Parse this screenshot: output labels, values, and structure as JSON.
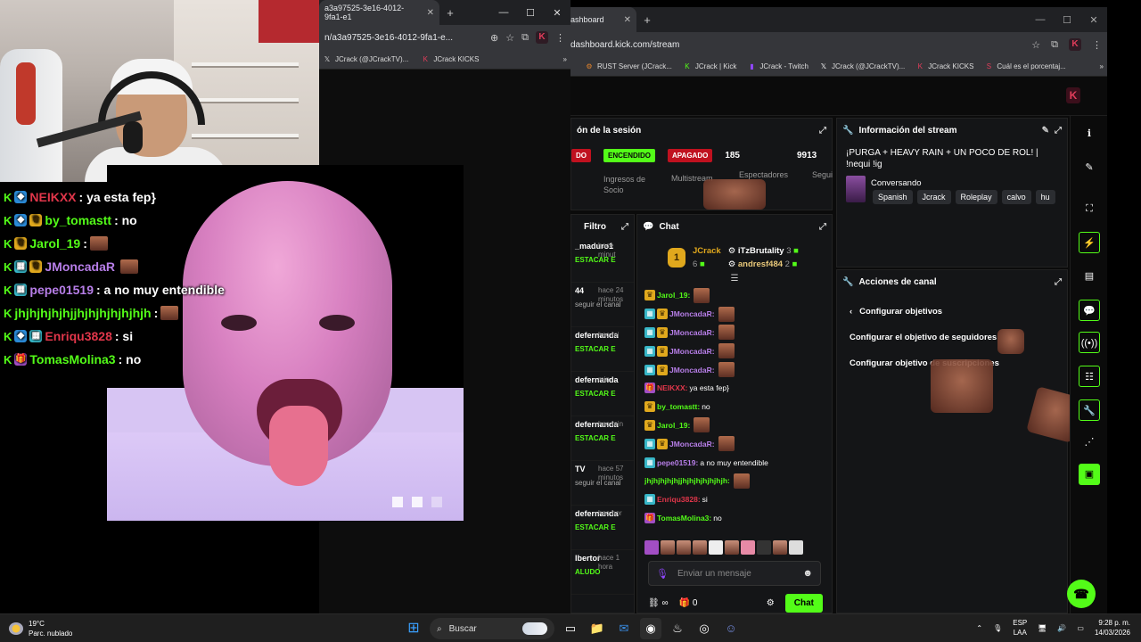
{
  "left_browser": {
    "tab_title": "a3a97525-3e16-4012-9fa1-e1",
    "address": "n/a3a97525-3e16-4012-9fa1-e...",
    "bookmarks": [
      "JCrack (@JCrackTV)...",
      "JCrack KICKS"
    ]
  },
  "overlay_chat": [
    {
      "user": "NEIKXX",
      "color": "#e0364a",
      "badges": [
        "blue"
      ],
      "message": ": ya esta fep}"
    },
    {
      "user": "by_tomastt",
      "color": "#53fc18",
      "badges": [
        "blue",
        "crown"
      ],
      "message": ": no"
    },
    {
      "user": "Jarol_19",
      "color": "#53fc18",
      "badges": [
        "crown"
      ],
      "message": ":",
      "emote": true
    },
    {
      "user": "JMoncadaR",
      "color": "#b77ee8",
      "badges": [
        "sub",
        "crown"
      ],
      "message": "",
      "emote": true
    },
    {
      "user": "pepe01519",
      "color": "#b77ee8",
      "badges": [
        "sub"
      ],
      "message": ": a no muy entendible"
    },
    {
      "user": "jhjhjhjhjhjjhjhjhjhjhjhjh",
      "color": "#53fc18",
      "badges": [],
      "message": ":",
      "emote": true
    },
    {
      "user": "Enriqu3828",
      "color": "#e0364a",
      "badges": [
        "blue",
        "sub"
      ],
      "message": ": si"
    },
    {
      "user": "TomasMolina3",
      "color": "#53fc18",
      "badges": [
        "gift"
      ],
      "message": ": no"
    }
  ],
  "right_browser": {
    "tab_title": "ashboard",
    "address": "dashboard.kick.com/stream",
    "bookmarks": [
      "RUST Server (JCrack...",
      "JCrack | Kick",
      "JCrack - Twitch",
      "JCrack (@JCrackTV)...",
      "JCrack KICKS",
      "Cuál es el porcentaj..."
    ]
  },
  "session": {
    "title": "ón de la sesión",
    "pill_cut": "DO",
    "pill_on": "ENCENDIDO",
    "pill_off": "APAGADO",
    "label_partner": "Ingresos de Socio",
    "label_multistream": "Multistream",
    "viewers": "185",
    "viewers_label": "Espectadores",
    "followers": "9913",
    "followers_label": "Segui"
  },
  "stream_info": {
    "title": "Información del stream",
    "stream_title": "¡PURGA + HEAVY RAIN + UN POCO DE ROL! | !nequi !ig",
    "category": "Conversando",
    "tags": [
      "Spanish",
      "Jcrack",
      "Roleplay",
      "calvo",
      "hu"
    ]
  },
  "filter": {
    "title": "Filtro",
    "items": [
      {
        "name": "_maduro1",
        "time": "hace minut",
        "action": "ESTACAR E"
      },
      {
        "name": "44",
        "time": "hace 24 minutos",
        "sub": "seguir el canal"
      },
      {
        "name": "defernanda",
        "time": "hac mi",
        "action": "ESTACAR E"
      },
      {
        "name": "defernanda",
        "time": "min",
        "action": "ESTACAR E"
      },
      {
        "name": "defernanda",
        "time": "hac min",
        "action": "ESTACAR E"
      },
      {
        "name": "TV",
        "time": "hace 57 minutos",
        "sub": "seguir el canal"
      },
      {
        "name": "defernanda",
        "time": "hac hor",
        "action": "ESTACAR E"
      },
      {
        "name": "lbertor",
        "time": "hace 1 hora",
        "action": "ALUDO"
      }
    ]
  },
  "chat": {
    "title": "Chat",
    "gifter1": {
      "rank": "1",
      "name": "JCrack",
      "count": "6"
    },
    "gifter2": {
      "name": "iTzBrutality",
      "count": "3"
    },
    "gifter3": {
      "name": "andresf484",
      "count": "2"
    },
    "messages": [
      {
        "user": "Jarol_19:",
        "color": "#53fc18",
        "badges": [
          "crown"
        ],
        "text": "",
        "emote": true
      },
      {
        "user": "JMoncadaR:",
        "color": "#b77ee8",
        "badges": [
          "sub",
          "crown"
        ],
        "text": "",
        "emote": true
      },
      {
        "user": "JMoncadaR:",
        "color": "#b77ee8",
        "badges": [
          "sub",
          "crown"
        ],
        "text": "",
        "emote": true
      },
      {
        "user": "JMoncadaR:",
        "color": "#b77ee8",
        "badges": [
          "sub",
          "crown"
        ],
        "text": "",
        "emote": true
      },
      {
        "user": "JMoncadaR:",
        "color": "#b77ee8",
        "badges": [
          "sub",
          "crown"
        ],
        "text": "",
        "emote": true
      },
      {
        "user": "NEIKXX:",
        "color": "#e0364a",
        "badges": [
          "gift"
        ],
        "text": " ya esta fep}"
      },
      {
        "user": "by_tomastt:",
        "color": "#53fc18",
        "badges": [
          "crown"
        ],
        "text": " no"
      },
      {
        "user": "Jarol_19:",
        "color": "#53fc18",
        "badges": [
          "crown"
        ],
        "text": "",
        "emote": true
      },
      {
        "user": "JMoncadaR:",
        "color": "#b77ee8",
        "badges": [
          "sub",
          "crown"
        ],
        "text": "",
        "emote": true
      },
      {
        "user": "pepe01519:",
        "color": "#b77ee8",
        "badges": [
          "sub"
        ],
        "text": " a no muy entendible"
      },
      {
        "user": "jhjhjhjhjhjjhjhjhjhjhjhjh:",
        "color": "#53fc18",
        "badges": [],
        "text": "",
        "emote": true
      },
      {
        "user": "Enriqu3828:",
        "color": "#e0364a",
        "badges": [
          "sub"
        ],
        "text": " si"
      },
      {
        "user": "TomasMolina3:",
        "color": "#53fc18",
        "badges": [
          "gift"
        ],
        "text": " no"
      }
    ],
    "input_placeholder": "Enviar un mensaje",
    "points": "0",
    "send_label": "Chat"
  },
  "actions": {
    "title": "Acciones de canal",
    "back_label": "Configurar objetivos",
    "items": [
      "Configurar el objetivo de seguidores",
      "Configurar objetivo de suscripciones"
    ]
  },
  "taskbar": {
    "temp": "19°C",
    "weather": "Parc. nublado",
    "search": "Buscar",
    "lang1": "ESP",
    "lang2": "LAA",
    "time": "9:28 p. m.",
    "date": "14/03/2026"
  },
  "colors": {
    "kick_green": "#53fc18",
    "kick_red": "#e33d5b"
  }
}
